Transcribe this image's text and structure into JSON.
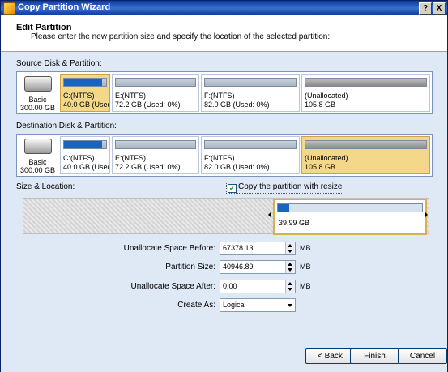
{
  "window": {
    "title": "Copy Partition Wizard",
    "help_btn": "?",
    "close_btn": "X"
  },
  "header": {
    "title": "Edit Partition",
    "subtitle": "Please enter the new partition size and specify the location of the selected partition:"
  },
  "source": {
    "label": "Source Disk & Partition:",
    "disk": {
      "type": "Basic",
      "size": "300.00 GB"
    },
    "partitions": [
      {
        "name": "C:(NTFS)",
        "detail": "40.0 GB (Used",
        "selected": true,
        "used_fraction": 0.9
      },
      {
        "name": "E:(NTFS)",
        "detail": "72.2 GB (Used: 0%)",
        "selected": false,
        "used_fraction": 0
      },
      {
        "name": "F:(NTFS)",
        "detail": "82.0 GB (Used: 0%)",
        "selected": false,
        "used_fraction": 0
      },
      {
        "name": "(Unallocated)",
        "detail": "105.8 GB",
        "selected": false,
        "used_fraction": 0
      }
    ]
  },
  "destination": {
    "label": "Destination Disk & Partition:",
    "disk": {
      "type": "Basic",
      "size": "300.00 GB"
    },
    "partitions": [
      {
        "name": "C:(NTFS)",
        "detail": "40.0 GB (Used",
        "selected": false,
        "used_fraction": 0.9
      },
      {
        "name": "E:(NTFS)",
        "detail": "72.2 GB (Used: 0%)",
        "selected": false,
        "used_fraction": 0
      },
      {
        "name": "F:(NTFS)",
        "detail": "82.0 GB (Used: 0%)",
        "selected": false,
        "used_fraction": 0
      },
      {
        "name": "(Unallocated)",
        "detail": "105.8 GB",
        "selected": true,
        "used_fraction": 0
      }
    ]
  },
  "size_location": {
    "label": "Size & Location:",
    "copy_with_resize_label": "Copy the partition with resize",
    "copy_with_resize_checked": true,
    "block_size": "39.99 GB"
  },
  "fields": {
    "unalloc_before": {
      "label": "Unallocate Space Before:",
      "value": "67378.13",
      "unit": "MB"
    },
    "partition_size": {
      "label": "Partition Size:",
      "value": "40946.89",
      "unit": "MB"
    },
    "unalloc_after": {
      "label": "Unallocate Space After:",
      "value": "0.00",
      "unit": "MB"
    },
    "create_as": {
      "label": "Create As:",
      "value": "Logical"
    }
  },
  "buttons": {
    "back": "< Back",
    "finish": "Finish",
    "cancel": "Cancel"
  }
}
